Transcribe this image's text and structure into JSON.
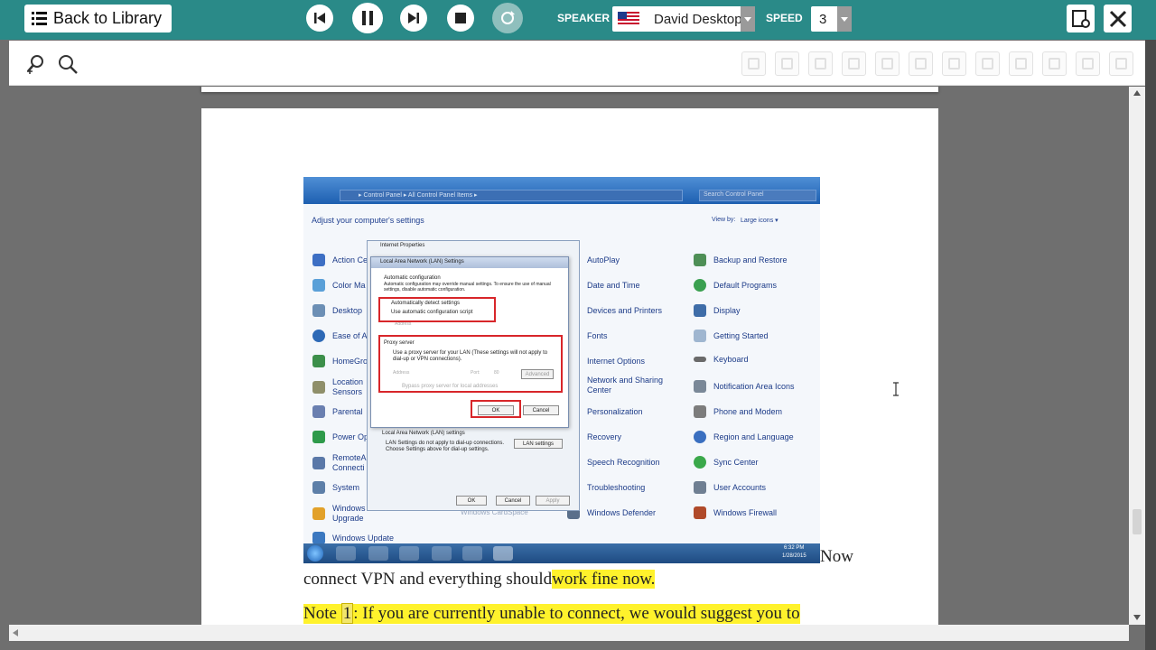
{
  "topbar": {
    "back_label": "Back to Library",
    "speaker_label": "SPEAKER",
    "speaker_value": "David Desktop",
    "speed_label": "SPEED",
    "speed_value": "3"
  },
  "doc": {
    "line1_tail": "Now",
    "line2_plain": "connect VPN and everything should",
    "line2_highlight": "work fine now.",
    "line3_prefix": "Note",
    "line3_num": "1",
    "line3_rest": ": If you are currently unable to connect, we would suggest you to"
  },
  "screenshot": {
    "breadcrumb": "▸ Control Panel ▸ All Control Panel Items ▸",
    "search_placeholder": "Search Control Panel",
    "heading": "Adjust your computer's settings",
    "view_by": "View by:",
    "view_by_value": "Large icons ▾",
    "col1": [
      "Action Ce",
      "Color Ma",
      "Desktop",
      "Ease of A",
      "HomeGro",
      "Location Sensors",
      "Parental",
      "Power Op",
      "RemoteA Connecti",
      "System",
      "Windows Upgrade",
      "Windows Update"
    ],
    "col2": [
      "AutoPlay",
      "Date and Time",
      "Devices and Printers",
      "Fonts",
      "Internet Options",
      "Network and Sharing Center",
      "Personalization",
      "Recovery",
      "Speech Recognition",
      "Troubleshooting",
      "Windows Defender"
    ],
    "col3": [
      "Backup and Restore",
      "Default Programs",
      "Display",
      "Getting Started",
      "Keyboard",
      "Notification Area Icons",
      "Phone and Modem",
      "Region and Language",
      "Sync Center",
      "User Accounts",
      "Windows Firewall"
    ],
    "dialog_outer_title": "Internet Properties",
    "dialog_title": "Local Area Network (LAN) Settings",
    "auto_config": "Automatic configuration",
    "auto_desc": "Automatic configuration may override manual settings. To ensure the use of manual settings, disable automatic configuration.",
    "auto_detect": "Automatically detect settings",
    "use_script": "Use automatic configuration script",
    "address_label": "Address",
    "proxy_server": "Proxy server",
    "proxy_desc": "Use a proxy server for your LAN (These settings will not apply to dial-up or VPN connections).",
    "port_label": "Port:",
    "port_value": "80",
    "advanced": "Advanced",
    "bypass": "Bypass proxy server for local addresses",
    "ok": "OK",
    "cancel": "Cancel",
    "lan_section": "Local Area Network (LAN) settings",
    "lan_desc": "LAN Settings do not apply to dial-up connections. Choose Settings above for dial-up settings.",
    "lan_settings_btn": "LAN settings",
    "outer_ok": "OK",
    "outer_cancel": "Cancel",
    "outer_apply": "Apply",
    "cardspace": "Windows CardSpace",
    "clock_time": "6:32 PM",
    "clock_date": "1/28/2015"
  }
}
